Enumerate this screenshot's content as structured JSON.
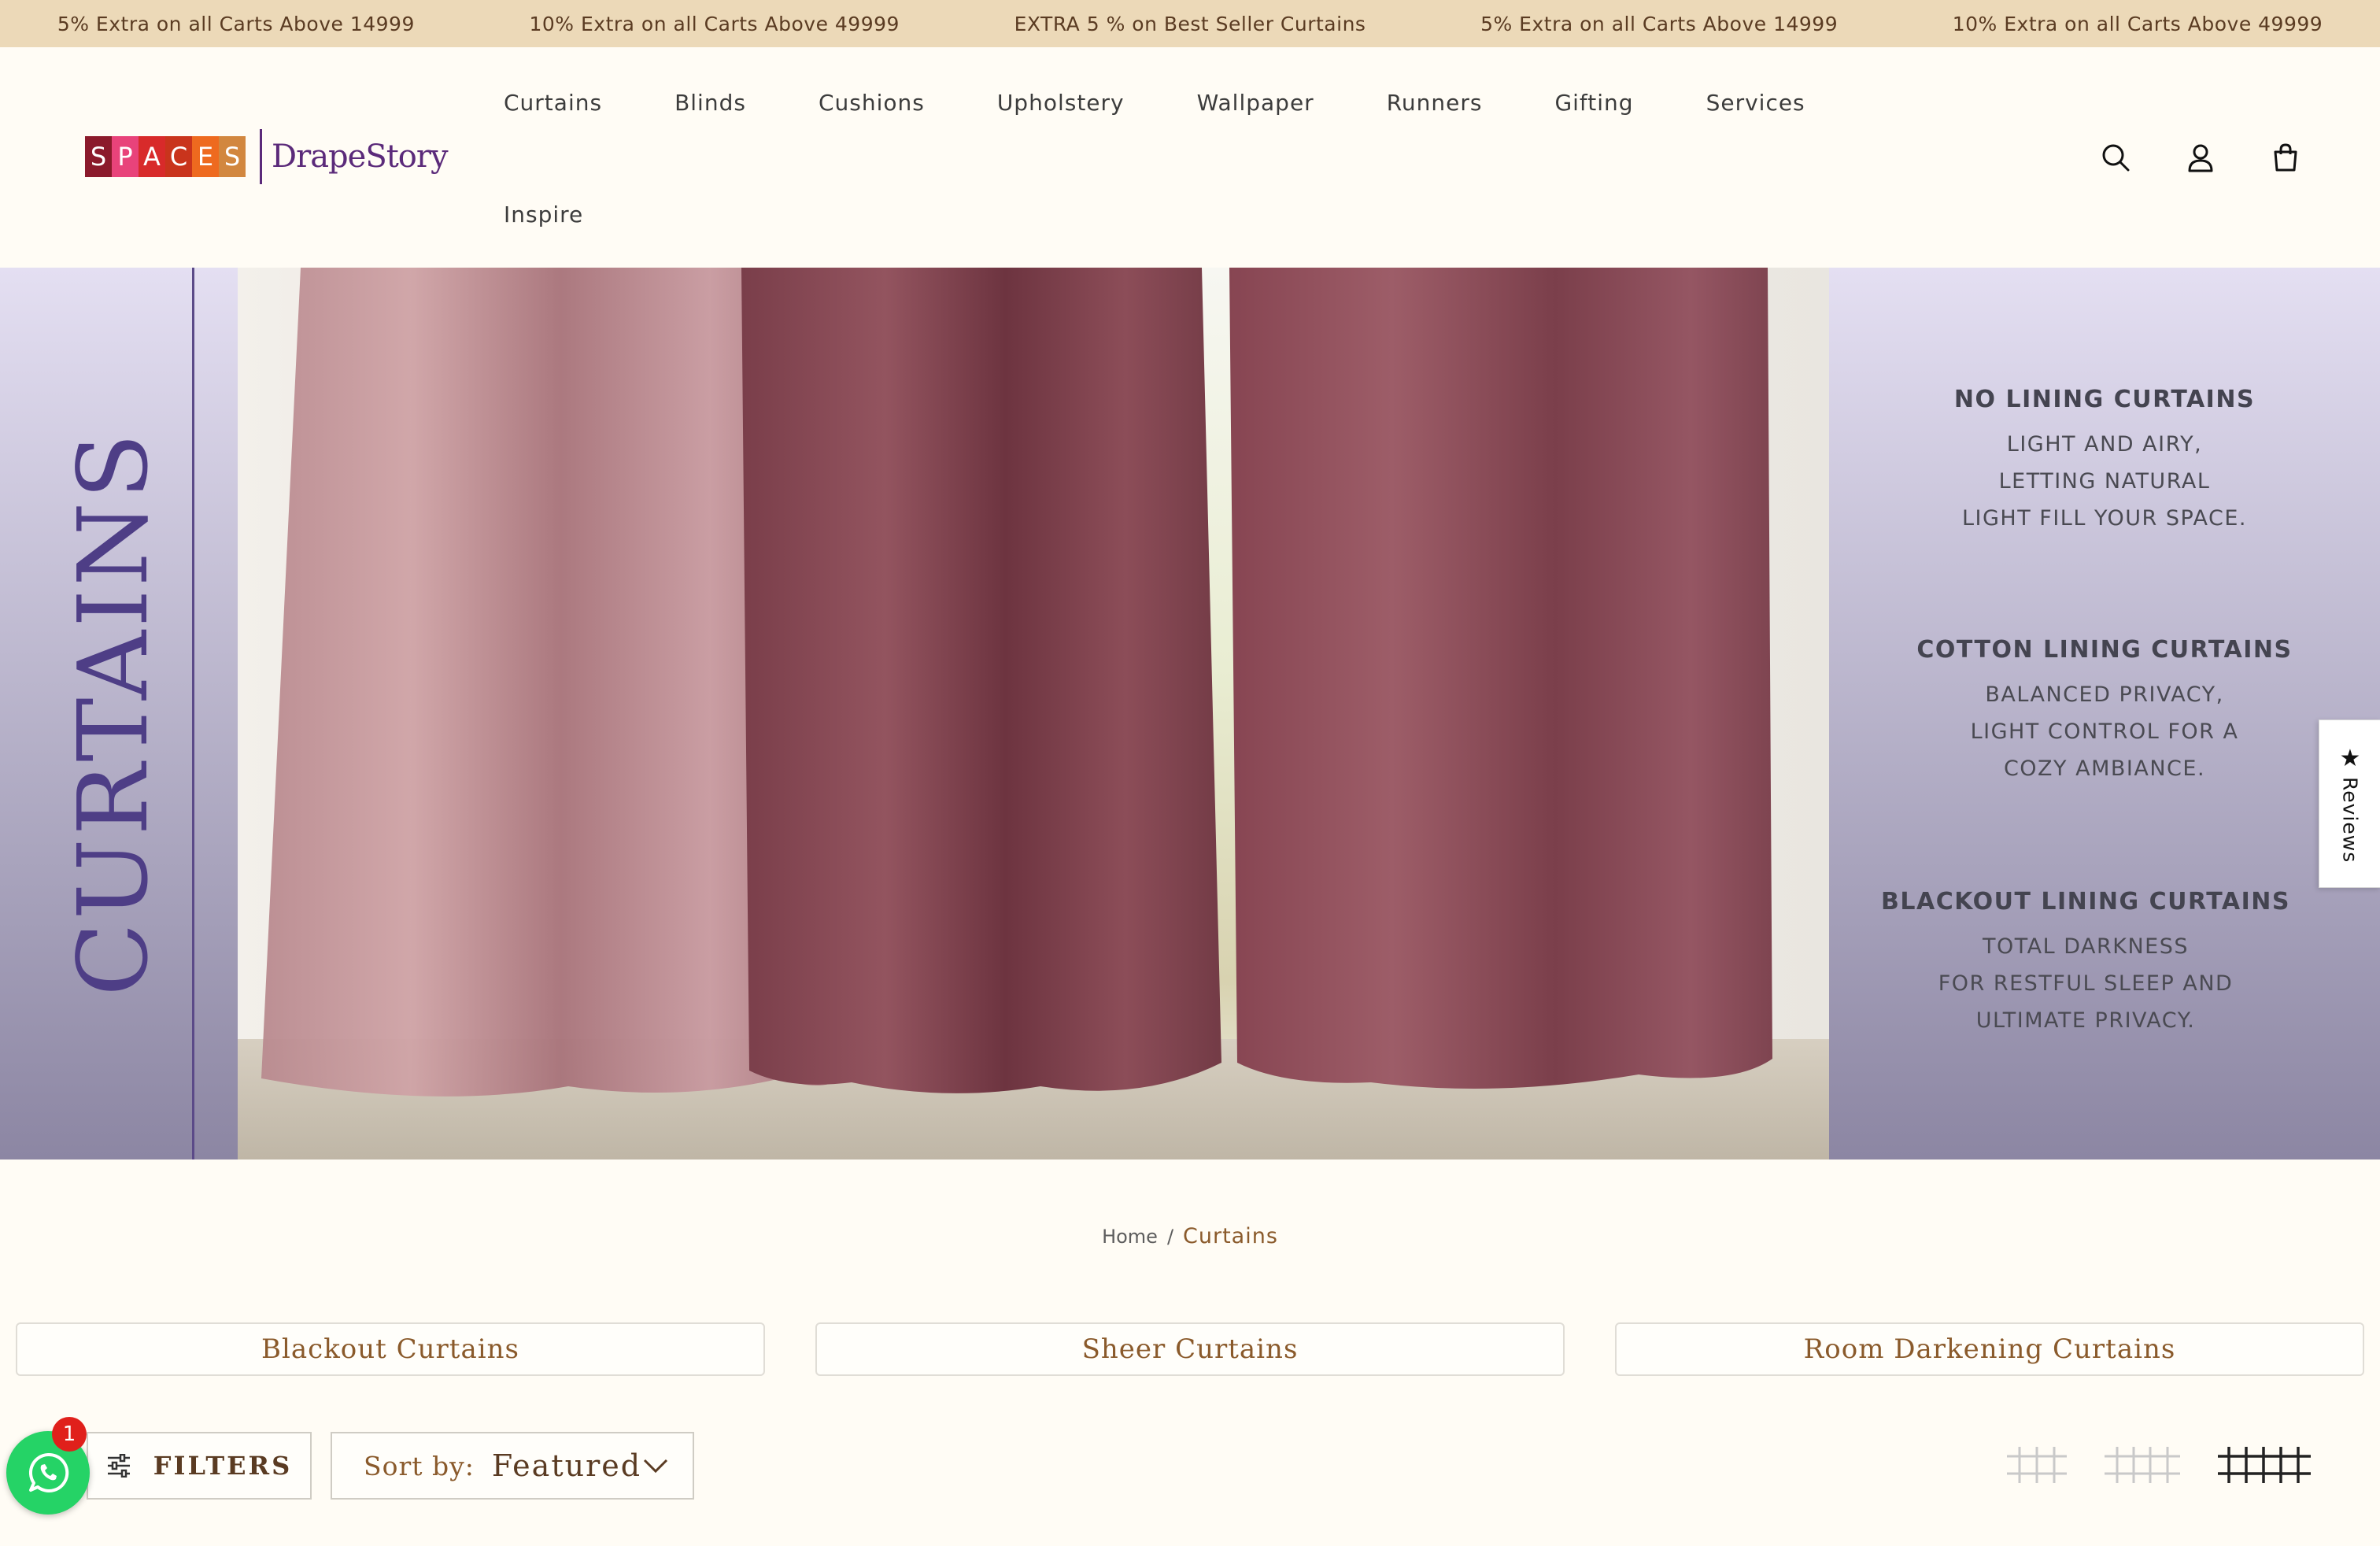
{
  "announcements": [
    "5% Extra on all Carts Above 14999",
    "10% Extra on all Carts Above 49999",
    "EXTRA 5 % on Best Seller Curtains",
    "5% Extra on all Carts Above 14999",
    "10% Extra on all Carts Above 49999"
  ],
  "logo": {
    "spaces_letters": [
      "S",
      "P",
      "A",
      "C",
      "E",
      "S"
    ],
    "spaces_colors": [
      "#8b1a2b",
      "#e8437a",
      "#d82a2a",
      "#c9341c",
      "#ee6a1f",
      "#d2873f"
    ],
    "brand": "DrapeStory"
  },
  "nav": {
    "row1": [
      "Curtains",
      "Blinds",
      "Cushions",
      "Upholstery",
      "Wallpaper",
      "Runners",
      "Gifting",
      "Services"
    ],
    "row2": [
      "Inspire"
    ]
  },
  "header_icons": [
    "search-icon",
    "account-icon",
    "cart-icon"
  ],
  "hero": {
    "title": "CURTAINS",
    "features": [
      {
        "heading": "NO LINING CURTAINS",
        "text": "LIGHT AND AIRY,\nLETTING NATURAL\nLIGHT FILL YOUR SPACE."
      },
      {
        "heading": "COTTON LINING CURTAINS",
        "text": "BALANCED PRIVACY,\nLIGHT CONTROL FOR A\nCOZY AMBIANCE."
      },
      {
        "heading": "BLACKOUT LINING CURTAINS",
        "text": "TOTAL DARKNESS\nFOR RESTFUL SLEEP AND\nULTIMATE PRIVACY."
      }
    ]
  },
  "breadcrumb": {
    "home": "Home",
    "separator": "/",
    "current": "Curtains"
  },
  "subcategories": [
    "Blackout Curtains",
    "Sheer Curtains",
    "Room Darkening Curtains"
  ],
  "toolbar": {
    "filters_label": "FILTERS",
    "sort_label": "Sort by:",
    "sort_value": "Featured",
    "grid_options": [
      "grid-2-icon",
      "grid-3-icon",
      "grid-4-icon"
    ],
    "active_grid": "grid-4-icon"
  },
  "reviews_tab": {
    "star": "★",
    "label": "Reviews"
  },
  "whatsapp": {
    "badge_count": "1"
  },
  "colors": {
    "announce_bg": "#ecd9b8",
    "page_bg": "#fffcf5",
    "accent_brown": "#8a5a2b",
    "brand_purple": "#5b2a7a",
    "curtain": "#8d4e5a",
    "whatsapp_green": "#25d366"
  }
}
